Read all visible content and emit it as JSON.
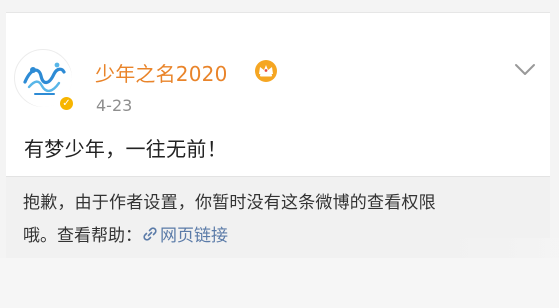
{
  "post": {
    "username": "少年之名2020",
    "date": "4-23",
    "content": "有梦少年，一往无前！",
    "icons": {
      "avatar": "avatar-logo",
      "badge": "crown-icon",
      "verified": "verified-icon",
      "menu": "chevron-down-icon"
    }
  },
  "notice": {
    "line1": "抱歉，由于作者设置，你暂时没有这条微博的查看权限",
    "line2_prefix": "哦。查看帮助：",
    "link_label": "网页链接"
  },
  "colors": {
    "username": "#e9842a",
    "link": "#5b7ba8",
    "text": "#222222"
  }
}
